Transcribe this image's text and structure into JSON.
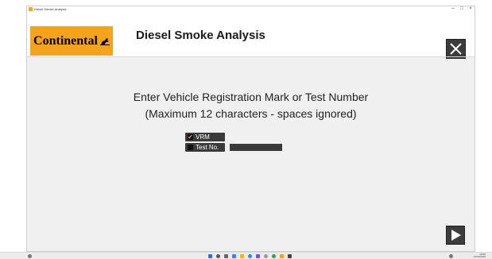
{
  "window": {
    "title": "Diesel Smoke Analysis",
    "controls": [
      "–",
      "□",
      "×"
    ]
  },
  "header": {
    "logo_text": "Continental",
    "logo_icon": "horse-icon",
    "app_title": "Diesel Smoke Analysis",
    "close_icon": "close-icon"
  },
  "instructions": {
    "line1": "Enter Vehicle Registration Mark or Test Number",
    "line2": "(Maximum 12 characters - spaces ignored)"
  },
  "options": [
    {
      "label": "VRM",
      "checked": true,
      "mark": "✔"
    },
    {
      "label": "Test No.",
      "checked": false,
      "mark": ""
    }
  ],
  "input": {
    "value": ""
  },
  "footer": {
    "next_icon": "play-arrow-icon"
  },
  "colors": {
    "brand_orange": "#f4a31b",
    "button_dark": "#3c3c3c",
    "panel_bg": "#f0f0f0"
  },
  "taskbar": {
    "time": "10:00",
    "date": "27/11/2023"
  }
}
